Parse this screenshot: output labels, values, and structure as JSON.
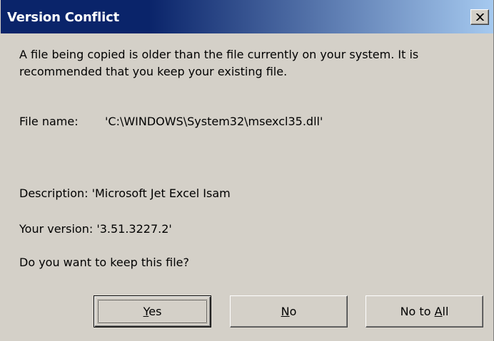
{
  "dialog": {
    "title": "Version Conflict",
    "close_symbol": "×",
    "message": "A file being copied is older than the file currently on your system.  It is recommended that you keep your existing file.",
    "file_name_label": "File name:",
    "file_name_value": "'C:\\WINDOWS\\System32\\msexcl35.dll'",
    "description_line": "Description:  'Microsoft Jet Excel Isam",
    "version_line": "Your version: '3.51.3227.2'",
    "question": "Do you want to keep this file?"
  },
  "buttons": {
    "yes": {
      "label": "Yes",
      "accel": "Y",
      "rest": "es"
    },
    "no": {
      "label": "No",
      "accel": "N",
      "rest": "o"
    },
    "no_to_all": {
      "label": "No to All",
      "prefix": "No to ",
      "accel": "A",
      "rest": "ll"
    }
  },
  "icons": {
    "close": "close-icon"
  },
  "colors": {
    "titlebar_start": "#0a246a",
    "titlebar_end": "#a6caf0",
    "face": "#d4d0c8"
  }
}
